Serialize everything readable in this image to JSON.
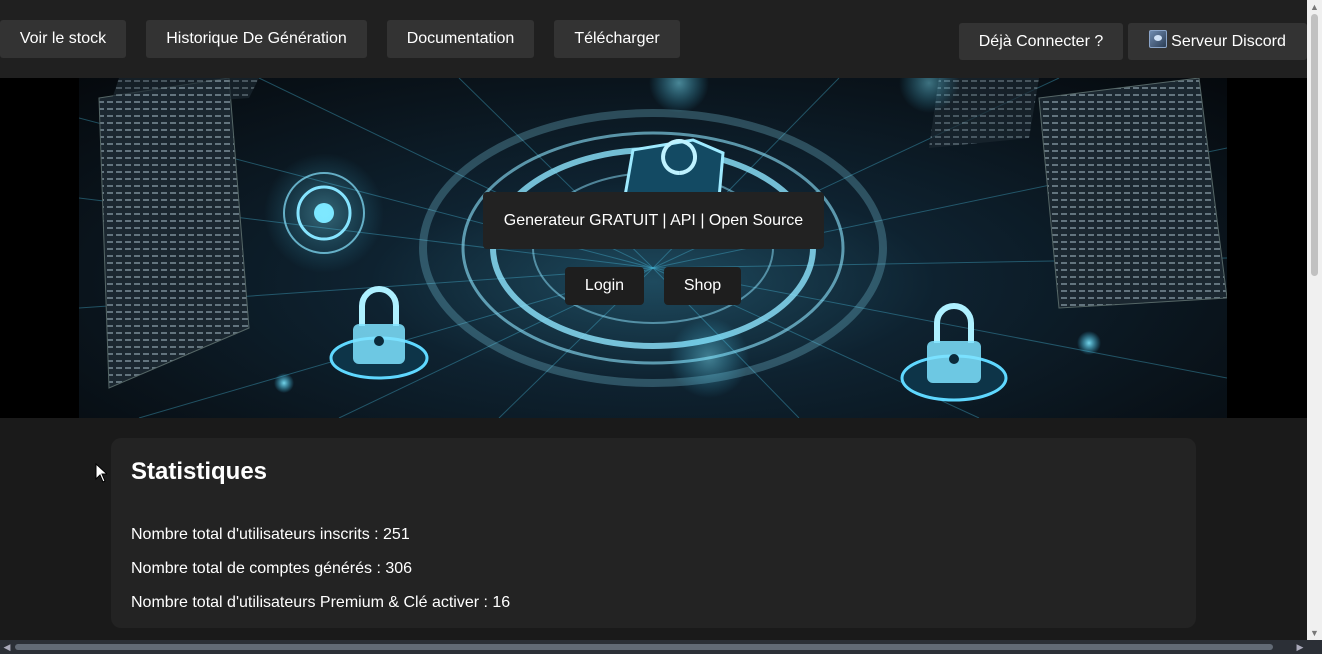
{
  "nav": {
    "left": [
      {
        "label": "Voir le stock"
      },
      {
        "label": "Historique De Génération"
      },
      {
        "label": "Documentation"
      },
      {
        "label": "Télécharger"
      }
    ],
    "right": [
      {
        "label": "Déjà Connecter ?"
      },
      {
        "label": "Serveur Discord",
        "icon": "discord-server-icon"
      }
    ]
  },
  "hero": {
    "title": "Generateur GRATUIT | API | Open Source",
    "login_label": "Login",
    "shop_label": "Shop",
    "image_icon": "cyber-security-illustration"
  },
  "stats": {
    "heading": "Statistiques",
    "items": [
      {
        "label": "Nombre total d'utilisateurs inscrits : 251"
      },
      {
        "label": "Nombre total de comptes générés : 306"
      },
      {
        "label": "Nombre total d'utilisateurs Premium & Clé activer : 16"
      }
    ]
  },
  "colors": {
    "background": "#1a1a1a",
    "topbar": "#202020",
    "button": "#333333",
    "card": "#232323",
    "accent": "#3fd0ff"
  }
}
